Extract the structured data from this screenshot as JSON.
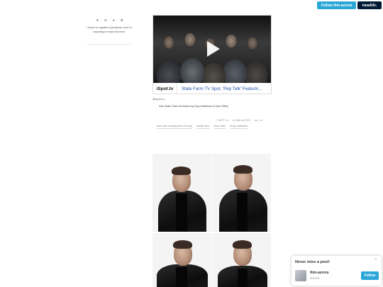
{
  "header": {
    "follow_label": "Follow thm-aurora",
    "brand_label": "tumblr."
  },
  "sidebar": {
    "icons": [
      "heart-icon",
      "mail-icon",
      "user-icon",
      "settings-icon"
    ],
    "description": "i know i'm capable of greatness, and i'm expecting to reach that level."
  },
  "post": {
    "video_provider": "iSpot.tv",
    "video_title": "State Farm TV Spot, 'Pep Talk' Featurin...",
    "source": "@ispotv-tv",
    "caption": "New State Farm Ad featuring Clay Matthews & Nick Offrey",
    "date": "7 SEPT 16",
    "notes": "24,585 NOTES",
    "reblog": "via / ⟲",
    "tags": [
      "#this was actually kind of funny",
      "#state farm",
      "#nick offer",
      "#clay matthews"
    ]
  },
  "photoset": {
    "photos": [
      "photo-1",
      "photo-2",
      "photo-3",
      "photo-4"
    ]
  },
  "popup": {
    "title": "Never miss a post!",
    "close": "×",
    "name": "thm-aurora",
    "subtitle": "aurora",
    "follow_label": "Follow"
  },
  "colors": {
    "accent": "#2aa7d8",
    "brand": "#001935",
    "link": "#1f4fa8"
  }
}
